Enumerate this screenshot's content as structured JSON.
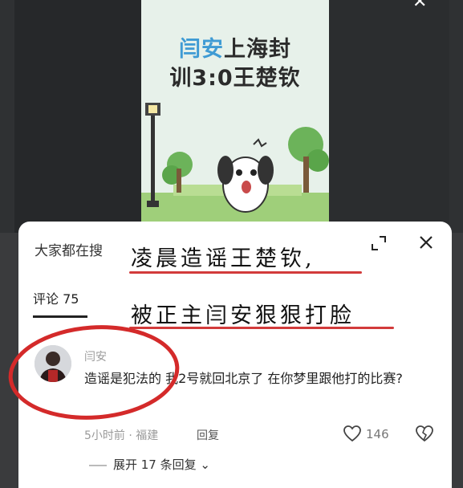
{
  "video": {
    "title_highlight": "闫安",
    "title_rest_line1": "上海封",
    "title_line2": "训3:0王楚钦"
  },
  "panel": {
    "search_label": "大家都在搜",
    "comments_tab": "评论 75",
    "handwritten_line1": "凌晨造谣王楚钦,",
    "handwritten_line2": "被正主闫安狠狠打脸"
  },
  "comment": {
    "username": "闫安",
    "text": "造谣是犯法的 我2号就回北京了 在你梦里跟他打的比赛?",
    "time_location": "5小时前 · 福建",
    "reply_label": "回复",
    "likes": "146",
    "expand_replies": "展开 17 条回复"
  },
  "colors": {
    "accent_red": "#d23b3b",
    "title_blue": "#3f9bd4"
  }
}
